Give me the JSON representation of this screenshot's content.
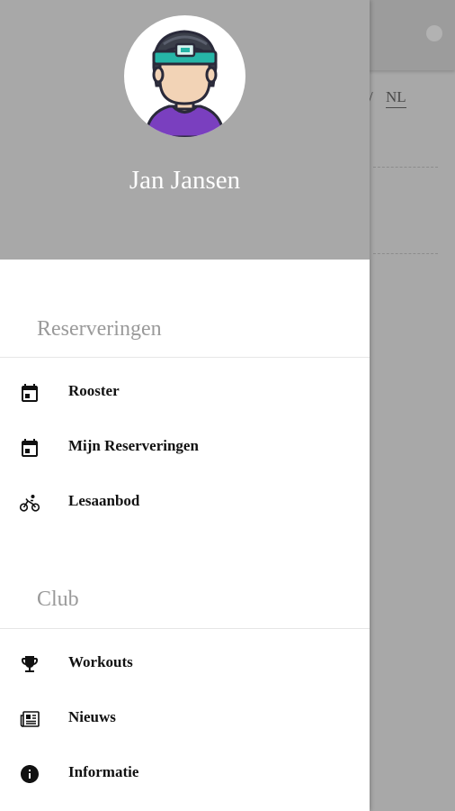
{
  "user": {
    "name": "Jan Jansen"
  },
  "background": {
    "language_sep": "/",
    "language_current": "NL"
  },
  "sections": [
    {
      "title": "Reserveringen",
      "items": [
        {
          "label": "Rooster",
          "icon": "calendar-icon"
        },
        {
          "label": "Mijn Reserveringen",
          "icon": "calendar-icon"
        },
        {
          "label": "Lesaanbod",
          "icon": "bicycle-icon"
        }
      ]
    },
    {
      "title": "Club",
      "items": [
        {
          "label": "Workouts",
          "icon": "trophy-icon"
        },
        {
          "label": "Nieuws",
          "icon": "newspaper-icon"
        },
        {
          "label": "Informatie",
          "icon": "info-icon"
        }
      ]
    }
  ],
  "colors": {
    "header_bg": "#a8a8a8",
    "drawer_bg": "#ffffff",
    "section_title": "#9a9a9a",
    "avatar_headband": "#26b5a7",
    "avatar_shirt": "#7a3fbf"
  }
}
